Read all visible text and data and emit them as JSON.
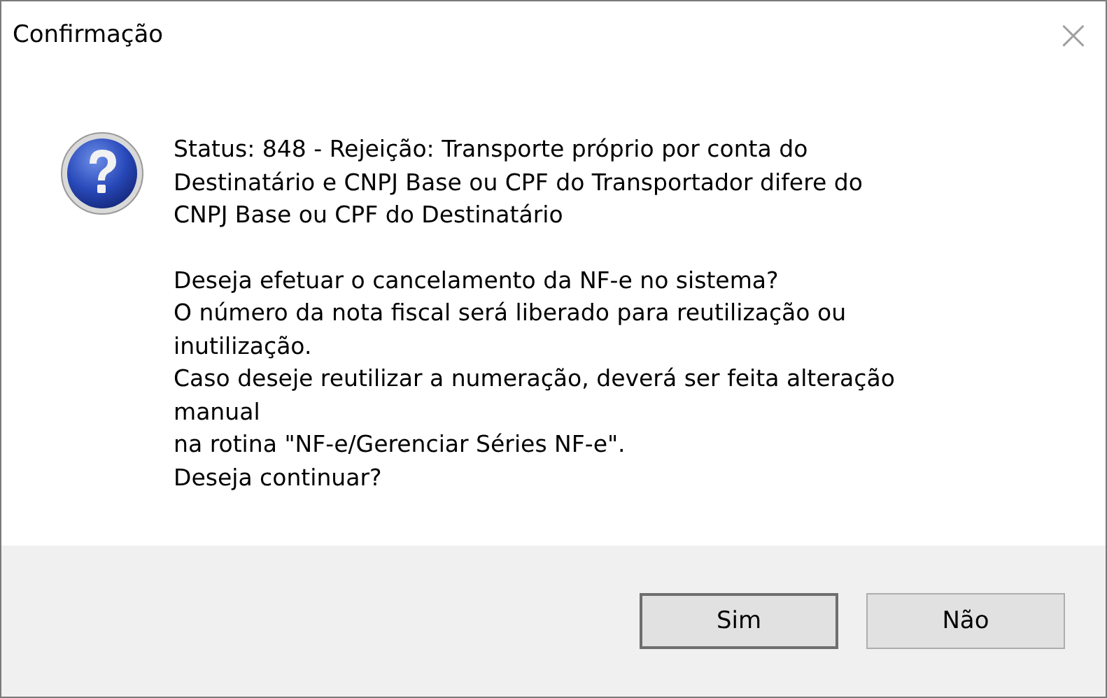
{
  "window": {
    "title": "Confirmação",
    "close": "×"
  },
  "message": {
    "paragraphs": [
      [
        "Status: 848 - Rejeição: Transporte próprio por conta do",
        "Destinatário e CNPJ Base ou CPF do Transportador difere do",
        "CNPJ Base ou CPF do Destinatário"
      ],
      [
        "Deseja efetuar o cancelamento da NF-e no sistema?",
        "O número da nota fiscal será liberado para reutilização ou",
        "inutilização.",
        "Caso deseje reutilizar a numeração, deverá ser feita alteração",
        "manual",
        "na rotina \"NF-e/Gerenciar Séries NF-e\".",
        "Deseja continuar?"
      ]
    ]
  },
  "buttons": [
    {
      "label": "Sim",
      "default": true
    },
    {
      "label": "Não",
      "default": false
    }
  ]
}
